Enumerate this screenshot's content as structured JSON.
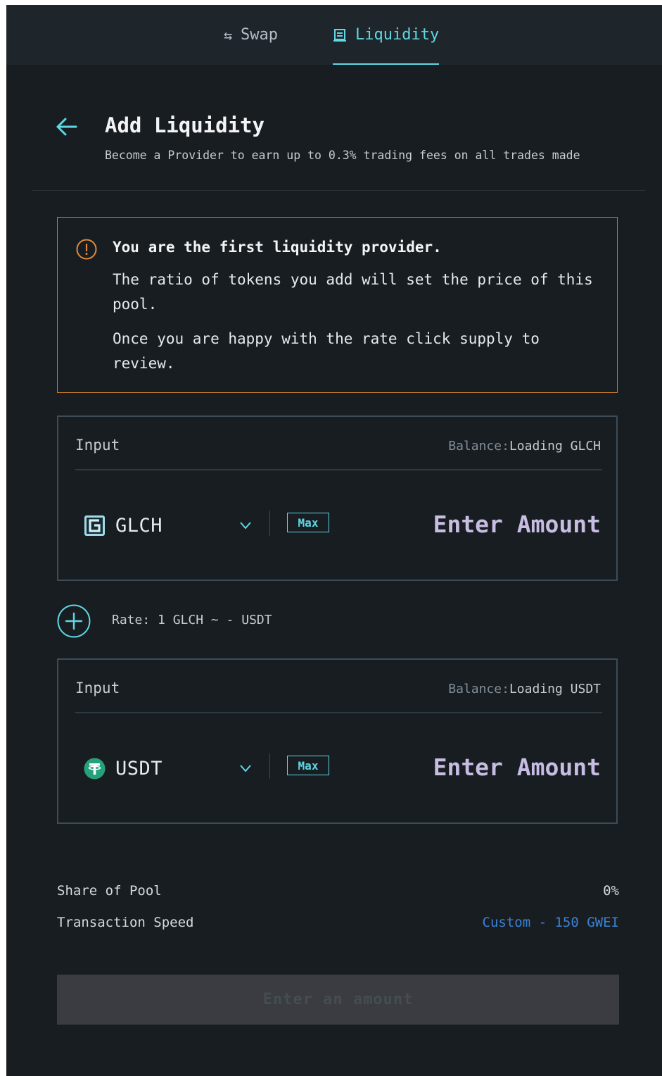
{
  "tabs": [
    {
      "label": "Swap",
      "icon": "swap-arrows-icon",
      "active": false
    },
    {
      "label": "Liquidity",
      "icon": "liquidity-icon",
      "active": true
    }
  ],
  "header": {
    "title": "Add Liquidity",
    "subtitle": "Become a Provider to earn up to 0.3% trading fees on all trades made"
  },
  "warning": {
    "title": "You are the first liquidity provider.",
    "line1": "The ratio of tokens you add will set the price of this pool.",
    "line2": "Once you are happy with the rate click supply to review."
  },
  "inputs": [
    {
      "label": "Input",
      "balance_label": "Balance:",
      "balance_value": "Loading GLCH",
      "token": "GLCH",
      "max_label": "Max",
      "placeholder": "Enter Amount"
    },
    {
      "label": "Input",
      "balance_label": "Balance:",
      "balance_value": "Loading USDT",
      "token": "USDT",
      "max_label": "Max",
      "placeholder": "Enter Amount"
    }
  ],
  "rate": "Rate: 1 GLCH ~ - USDT",
  "summary": {
    "share_label": "Share of Pool",
    "share_value": "0%",
    "speed_label": "Transaction Speed",
    "speed_value": "Custom - 150 GWEI"
  },
  "submit_label": "Enter an amount",
  "colors": {
    "accent": "#5ed8e4",
    "warning": "#c87a32",
    "link": "#3b82d6",
    "background": "#181d21"
  }
}
